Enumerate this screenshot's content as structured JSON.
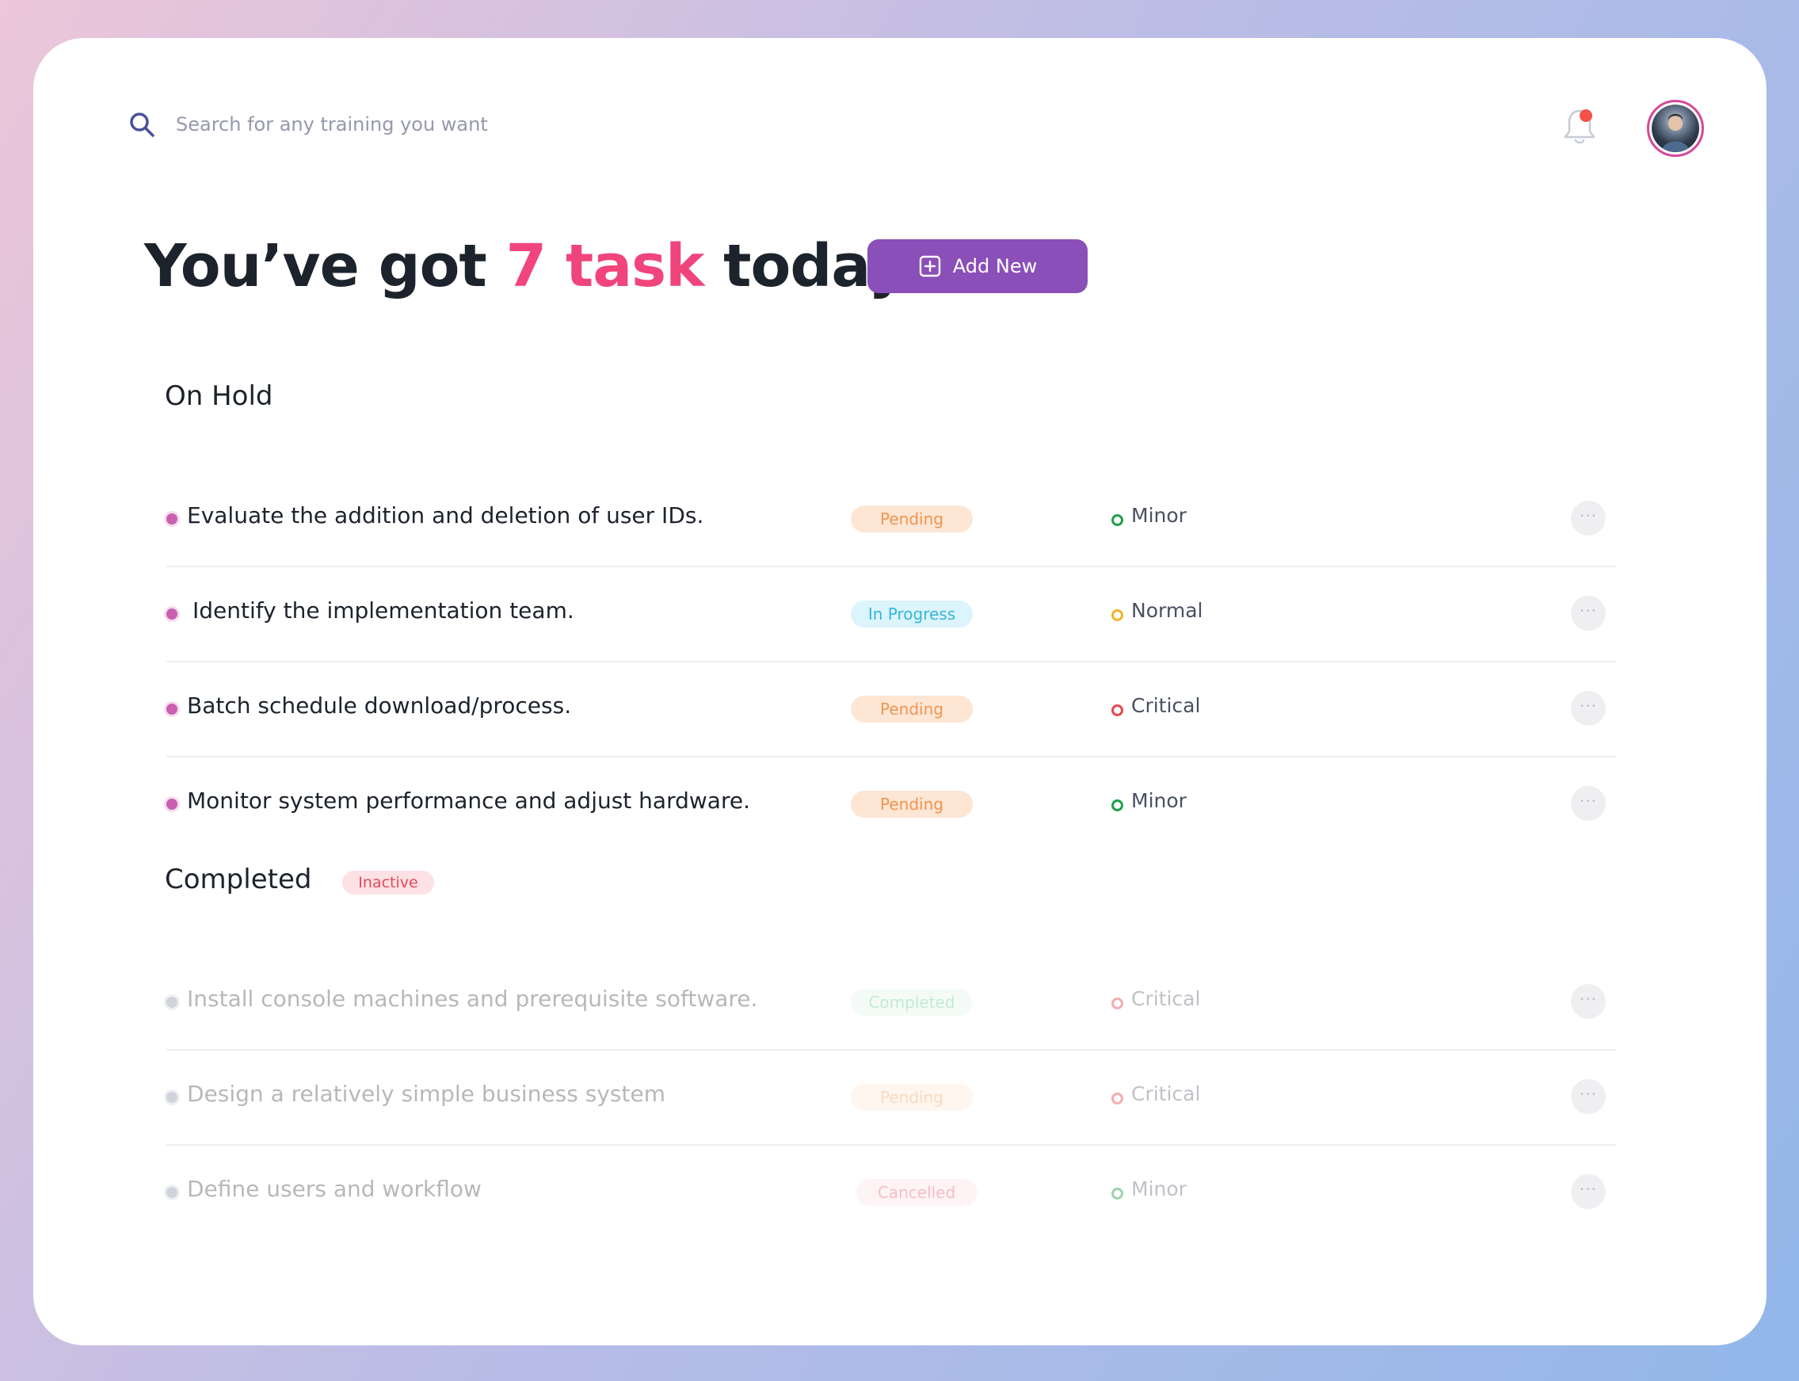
{
  "search": {
    "placeholder": "Search for any training you want"
  },
  "headline": {
    "prefix": "You’ve got ",
    "accent": "7 task",
    "suffix": " today"
  },
  "add_button": {
    "label": "Add New"
  },
  "colors": {
    "accent": "#f0457c",
    "primary": "#8a4fb8",
    "notification": "#f2524a"
  },
  "sections": [
    {
      "title": "On Hold",
      "badge": "",
      "tasks": [
        {
          "text": "Evaluate the addition and deletion of user IDs.",
          "status": "Pending",
          "priority": "Minor"
        },
        {
          "text": "Identify the implementation team.",
          "status": "In Progress",
          "priority": "Normal"
        },
        {
          "text": "Batch schedule download/process.",
          "status": "Pending",
          "priority": "Critical"
        },
        {
          "text": "Monitor system performance and adjust hardware.",
          "status": "Pending",
          "priority": "Minor"
        }
      ]
    },
    {
      "title": "Completed",
      "badge": "Inactive",
      "tasks": [
        {
          "text": "Install console machines and prerequisite software.",
          "status": "Completed",
          "priority": "Critical"
        },
        {
          "text": "Design a relatively simple business system",
          "status": "Pending",
          "priority": "Critical"
        },
        {
          "text": "Define users and workflow",
          "status": "Cancelled",
          "priority": "Minor"
        }
      ]
    }
  ],
  "priority_colors": {
    "Minor": "#20a04a",
    "Normal": "#f0b52a",
    "Critical": "#e8474e"
  },
  "more_glyph": "···"
}
